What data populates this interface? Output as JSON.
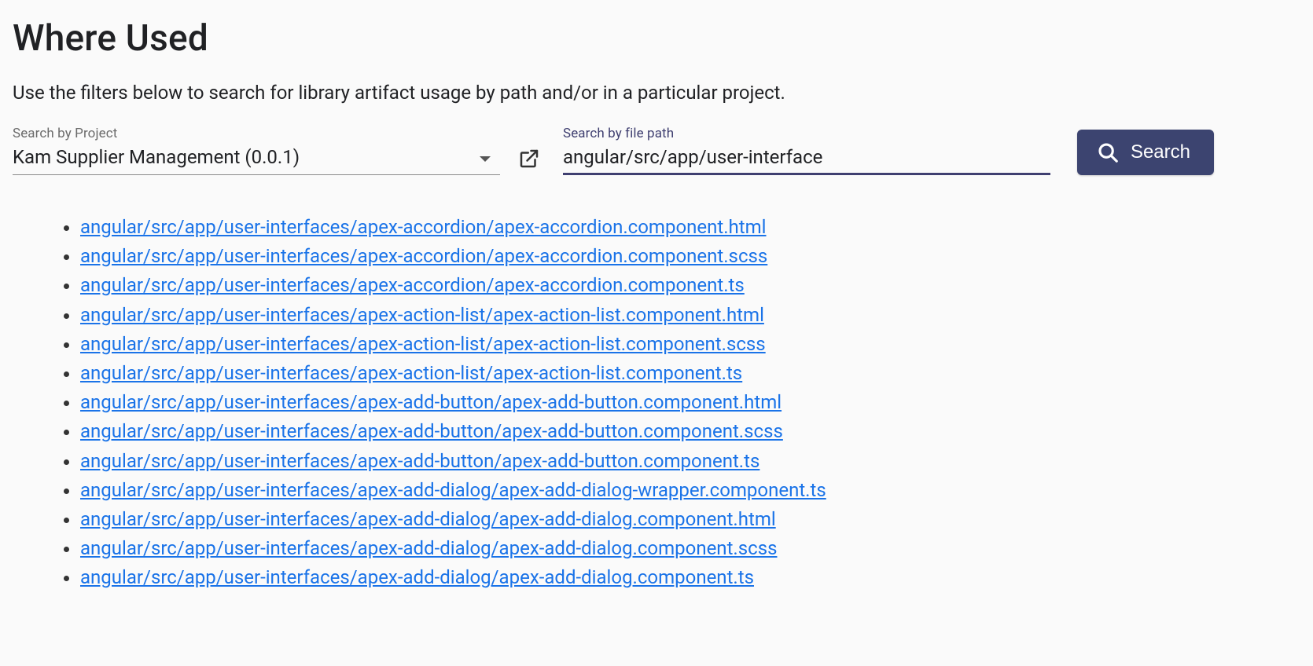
{
  "header": {
    "title": "Where Used",
    "description": "Use the filters below to search for library artifact usage by path and/or in a particular project."
  },
  "filters": {
    "project": {
      "label": "Search by Project",
      "selected": "Kam Supplier Management (0.0.1)"
    },
    "path": {
      "label": "Search by file path",
      "value": "angular/src/app/user-interface"
    },
    "search_button_label": "Search"
  },
  "results": [
    "angular/src/app/user-interfaces/apex-accordion/apex-accordion.component.html",
    "angular/src/app/user-interfaces/apex-accordion/apex-accordion.component.scss",
    "angular/src/app/user-interfaces/apex-accordion/apex-accordion.component.ts",
    "angular/src/app/user-interfaces/apex-action-list/apex-action-list.component.html",
    "angular/src/app/user-interfaces/apex-action-list/apex-action-list.component.scss",
    "angular/src/app/user-interfaces/apex-action-list/apex-action-list.component.ts",
    "angular/src/app/user-interfaces/apex-add-button/apex-add-button.component.html",
    "angular/src/app/user-interfaces/apex-add-button/apex-add-button.component.scss",
    "angular/src/app/user-interfaces/apex-add-button/apex-add-button.component.ts",
    "angular/src/app/user-interfaces/apex-add-dialog/apex-add-dialog-wrapper.component.ts",
    "angular/src/app/user-interfaces/apex-add-dialog/apex-add-dialog.component.html",
    "angular/src/app/user-interfaces/apex-add-dialog/apex-add-dialog.component.scss",
    "angular/src/app/user-interfaces/apex-add-dialog/apex-add-dialog.component.ts"
  ]
}
